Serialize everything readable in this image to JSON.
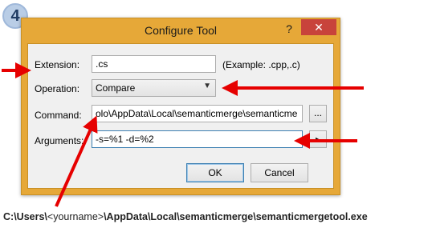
{
  "step_number": "4",
  "window": {
    "title": "Configure Tool",
    "help_label": "?",
    "close_label": "✕"
  },
  "form": {
    "extension_label": "Extension:",
    "extension_value": ".cs",
    "extension_hint": "(Example: .cpp,.c)",
    "operation_label": "Operation:",
    "operation_value": "Compare",
    "command_label": "Command:",
    "command_value": "olo\\AppData\\Local\\semanticmerge\\semanticme",
    "browse_label": "...",
    "arguments_label": "Arguments:",
    "arguments_value": "-s=%1 -d=%2",
    "arguments_menu_label": "▸"
  },
  "buttons": {
    "ok": "OK",
    "cancel": "Cancel"
  },
  "caption": {
    "path_start": "C:\\Users\\",
    "path_placeholder": "<yourname>",
    "path_end": "\\AppData\\Local\\semanticmerge\\semanticmergetool.exe"
  },
  "colors": {
    "annotation_arrow": "#e60000",
    "window_frame": "#e6a838",
    "close_button": "#c8433b",
    "badge": "#b9cde6"
  }
}
